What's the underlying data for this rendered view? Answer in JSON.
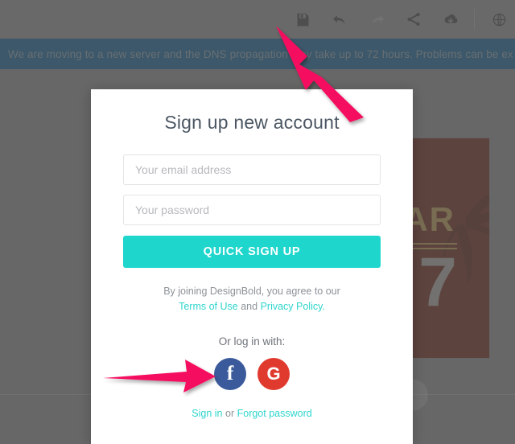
{
  "toolbar": {
    "items": [
      {
        "name": "save-icon",
        "label": "Save",
        "state": "enabled"
      },
      {
        "name": "undo-icon",
        "label": "Undo",
        "state": "enabled"
      },
      {
        "name": "redo-icon",
        "label": "Redo",
        "state": "disabled"
      },
      {
        "name": "share-icon",
        "label": "Share",
        "state": "enabled"
      },
      {
        "name": "download-icon",
        "label": "Download",
        "state": "enabled"
      },
      {
        "name": "globe-icon",
        "label": "Language",
        "state": "enabled"
      }
    ],
    "bg_color": "#808080",
    "icon_color": "#3b3b3b",
    "icon_disabled_color": "#9a9a9a"
  },
  "banner": {
    "text": "We are moving to a new server and the DNS propagation may take up to 72 hours. Problems can be ex",
    "bg_color": "#0d5584",
    "text_color": "#7f8f99"
  },
  "canvas": {
    "title_fragment": "AR",
    "year": "7",
    "bg_color": "#601e10",
    "title_color": "#a88b45",
    "year_color": "#9a9590"
  },
  "modal": {
    "title": "Sign up new account",
    "email_placeholder": "Your email address",
    "email_value": "",
    "password_placeholder": "Your password",
    "password_value": "",
    "submit_label": "QUICK SIGN UP",
    "submit_color": "#1fd6cd",
    "terms_prefix": "By joining DesignBold, you agree to our",
    "terms_link": "Terms of Use",
    "terms_conjunction": "and",
    "privacy_link": "Privacy Policy.",
    "or_label": "Or log in with:",
    "facebook_glyph": "f",
    "facebook_color": "#3b5a9b",
    "google_glyph": "G",
    "google_color": "#e03a2f",
    "signin_link": "Sign in",
    "footer_conjunction": "or",
    "forgot_link": "Forgot password",
    "link_color": "#2fd5cd"
  },
  "annotations": {
    "arrow_color": "#f5105e",
    "arrow_1_target": "save-icon",
    "arrow_2_target": "facebook-login-button"
  }
}
